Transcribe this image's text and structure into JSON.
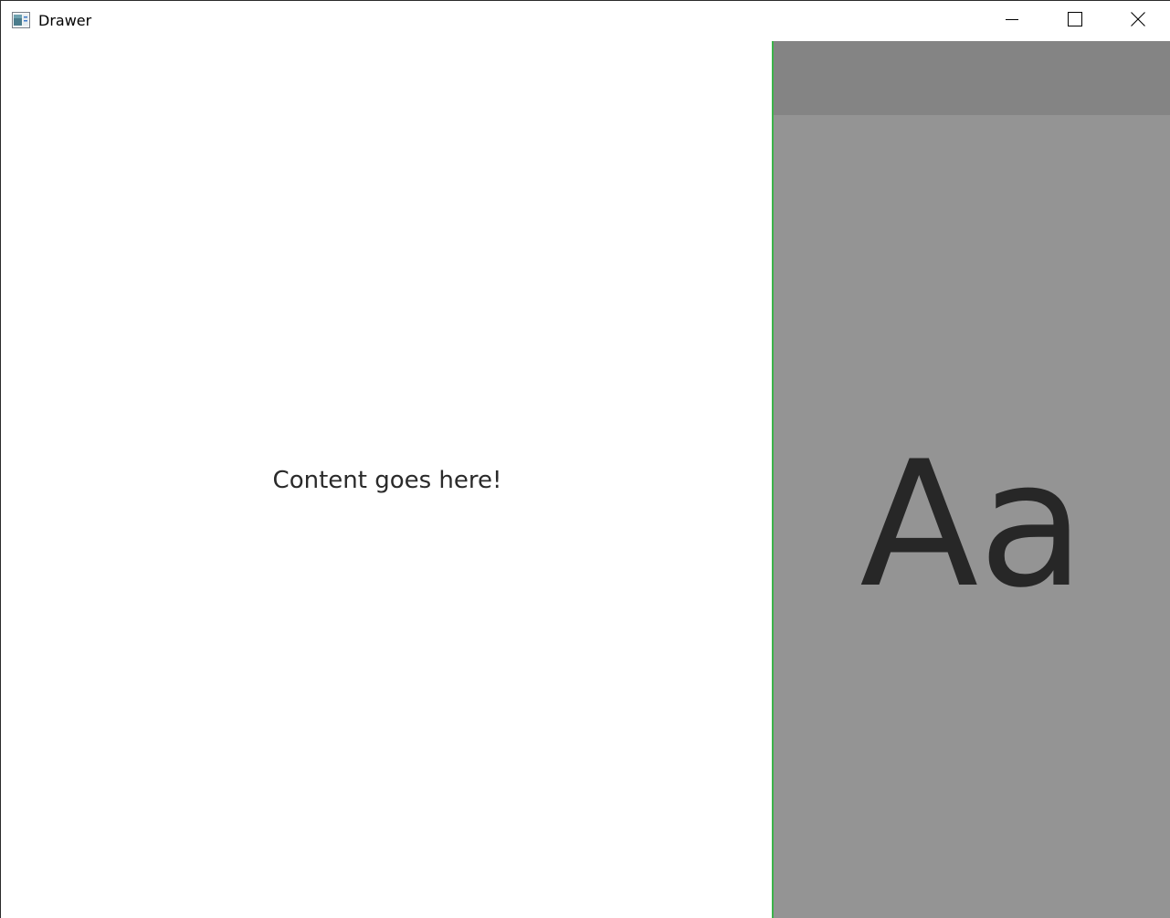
{
  "window": {
    "title": "Drawer",
    "app_icon": "app-window-icon",
    "controls": {
      "minimize_icon": "minimize-icon",
      "maximize_icon": "maximize-icon",
      "close_icon": "close-icon"
    }
  },
  "content": {
    "text": "Content goes here!"
  },
  "drawer": {
    "glyph": "Aa",
    "colors": {
      "background": "#949494",
      "header": "#848484",
      "accent_border": "#3cb34a"
    }
  }
}
